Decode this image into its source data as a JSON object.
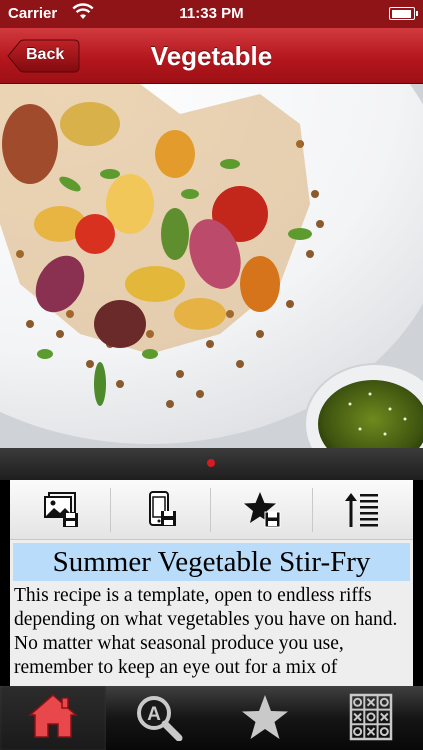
{
  "status_bar": {
    "carrier": "Carrier",
    "time": "11:33 PM",
    "battery_level": 0.92
  },
  "nav": {
    "back_label": "Back",
    "title": "Vegetable"
  },
  "colors": {
    "accent": "#b4171d",
    "title_highlight": "#b9dcfa",
    "pager_dot": "#d71b22",
    "home_tab": "#e8474c"
  },
  "pager": {
    "page_count": 1,
    "current_page": 1
  },
  "toolbar": {
    "items": [
      {
        "name": "photo-save",
        "icon": "image-save-icon"
      },
      {
        "name": "mobile-save",
        "icon": "phone-save-icon"
      },
      {
        "name": "favorite-save",
        "icon": "star-save-icon"
      },
      {
        "name": "text-size",
        "icon": "text-size-icon"
      }
    ]
  },
  "recipe": {
    "title": "Summer Vegetable Stir-Fry",
    "body": "This recipe is a template, open to endless riffs depending on what vegetables you have on hand. No matter what seasonal produce you use, remember to keep an eye out for a mix of"
  },
  "tabs": [
    {
      "name": "home",
      "icon": "home-icon",
      "active": true
    },
    {
      "name": "search",
      "icon": "search-icon",
      "active": false
    },
    {
      "name": "favorites",
      "icon": "star-icon",
      "active": false
    },
    {
      "name": "grid",
      "icon": "grid-icon",
      "active": false
    }
  ]
}
